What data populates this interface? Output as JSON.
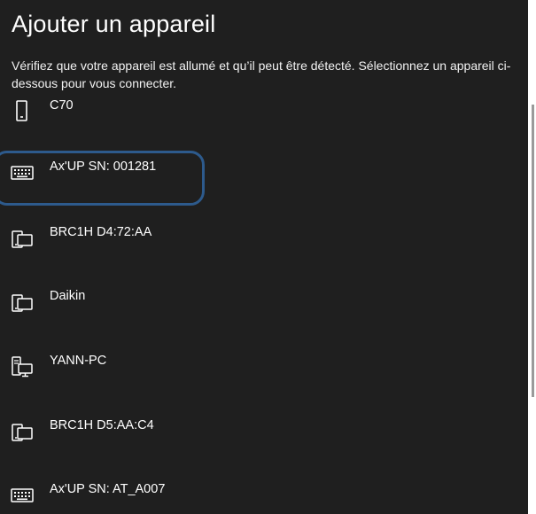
{
  "dialog": {
    "title": "Ajouter un appareil",
    "subtitle": "Vérifiez que votre appareil est allumé et qu’il peut être détecté. Sélectionnez un appareil ci-dessous pour vous connecter."
  },
  "devices": [
    {
      "name": "C70",
      "icon": "phone-icon"
    },
    {
      "name": "Ax'UP SN: 001281",
      "icon": "keyboard-icon"
    },
    {
      "name": "BRC1H D4:72:AA",
      "icon": "devices-icon"
    },
    {
      "name": "Daikin",
      "icon": "devices-icon"
    },
    {
      "name": "YANN-PC",
      "icon": "computer-icon"
    },
    {
      "name": "BRC1H D5:AA:C4",
      "icon": "devices-icon"
    },
    {
      "name": "Ax'UP SN: AT_A007",
      "icon": "keyboard-icon"
    }
  ],
  "colors": {
    "background": "#1f1f1f",
    "text": "#ffffff",
    "highlight_border": "#2d5a8c"
  }
}
